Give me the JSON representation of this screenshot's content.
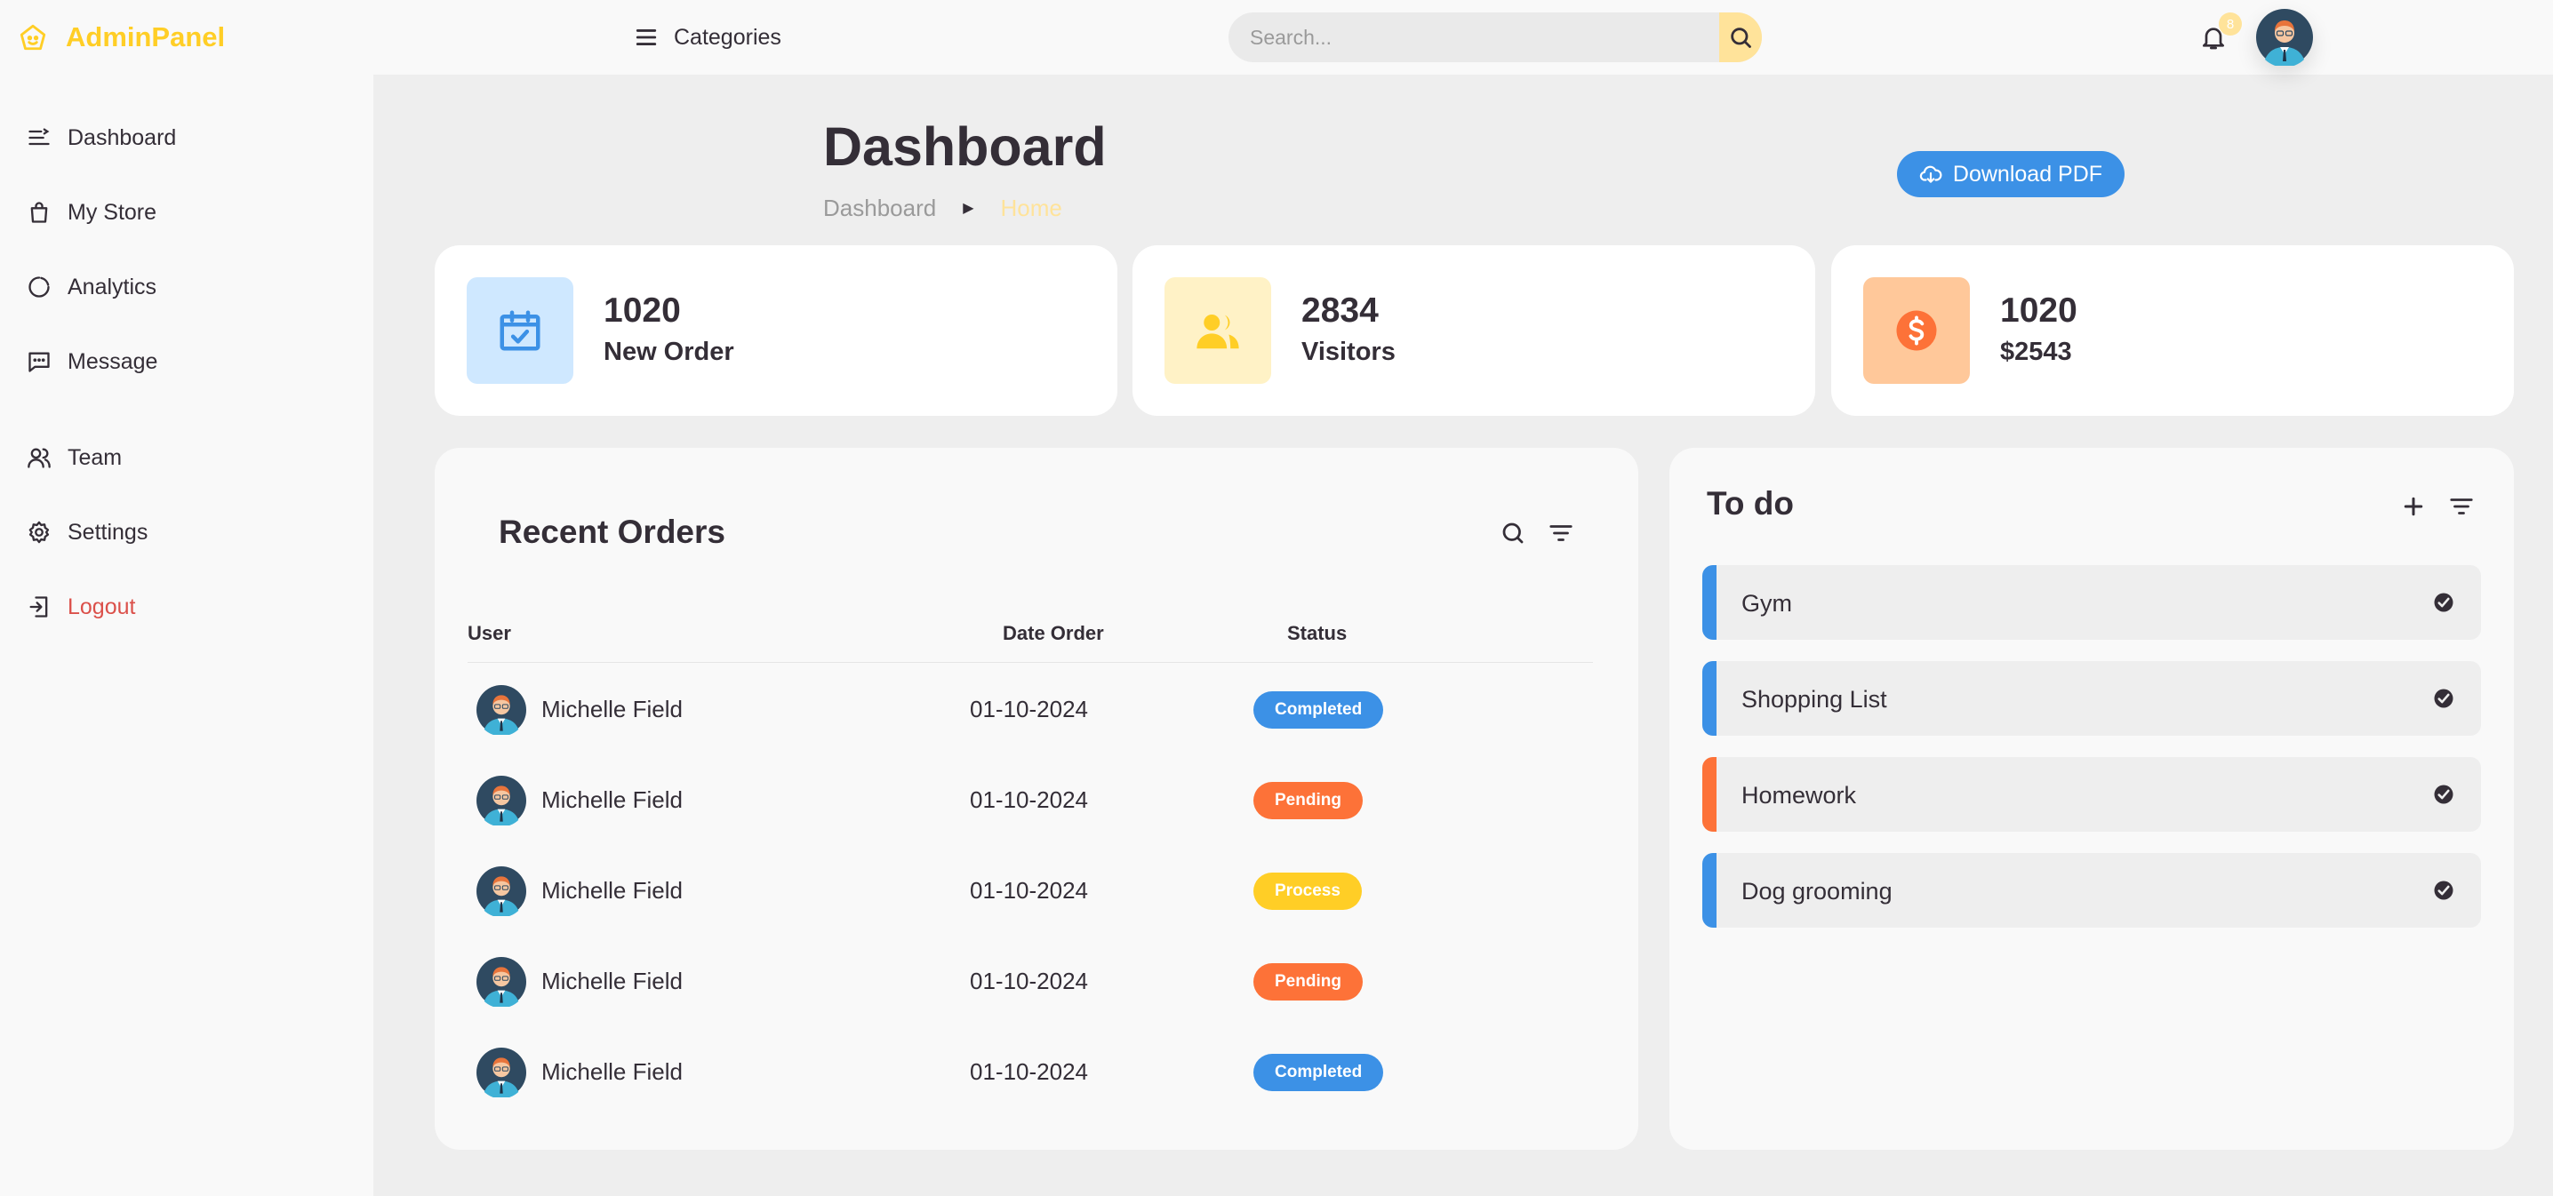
{
  "colors": {
    "blue": "#3c91e6",
    "light_blue": "#cfe8ff",
    "yellow": "#ffce26",
    "light_yellow": "#fff2c6",
    "orange": "#fd7238",
    "light_orange": "#ffe0d3",
    "red": "#db504a"
  },
  "brand": {
    "name": "AdminPanel",
    "icon": "smile-icon"
  },
  "sidebar": {
    "items": [
      {
        "label": "Dashboard",
        "icon": "dashboard-icon"
      },
      {
        "label": "My Store",
        "icon": "shopping-bag-icon"
      },
      {
        "label": "Analytics",
        "icon": "doughnut-chart-icon"
      },
      {
        "label": "Message",
        "icon": "message-icon"
      },
      {
        "label": "Team",
        "icon": "group-icon"
      },
      {
        "label": "Settings",
        "icon": "gear-icon"
      },
      {
        "label": "Logout",
        "icon": "logout-icon"
      }
    ]
  },
  "topbar": {
    "categories_label": "Categories",
    "search_placeholder": "Search...",
    "notification_count": "8"
  },
  "header": {
    "title": "Dashboard",
    "breadcrumb": [
      "Dashboard",
      "Home"
    ],
    "download_label": "Download PDF"
  },
  "stats": [
    {
      "value": "1020",
      "label": "New Order",
      "icon": "calendar-check-icon"
    },
    {
      "value": "2834",
      "label": "Visitors",
      "icon": "group-icon"
    },
    {
      "value": "1020",
      "label": "$2543",
      "icon": "dollar-circle-icon"
    }
  ],
  "orders": {
    "title": "Recent Orders",
    "columns": [
      "User",
      "Date Order",
      "Status"
    ],
    "rows": [
      {
        "user": "Michelle Field",
        "date": "01-10-2024",
        "status": "Completed"
      },
      {
        "user": "Michelle Field",
        "date": "01-10-2024",
        "status": "Pending"
      },
      {
        "user": "Michelle Field",
        "date": "01-10-2024",
        "status": "Process"
      },
      {
        "user": "Michelle Field",
        "date": "01-10-2024",
        "status": "Pending"
      },
      {
        "user": "Michelle Field",
        "date": "01-10-2024",
        "status": "Completed"
      }
    ]
  },
  "todo": {
    "title": "To do",
    "items": [
      {
        "text": "Gym"
      },
      {
        "text": "Shopping List"
      },
      {
        "text": "Homework"
      },
      {
        "text": "Dog grooming"
      }
    ]
  }
}
